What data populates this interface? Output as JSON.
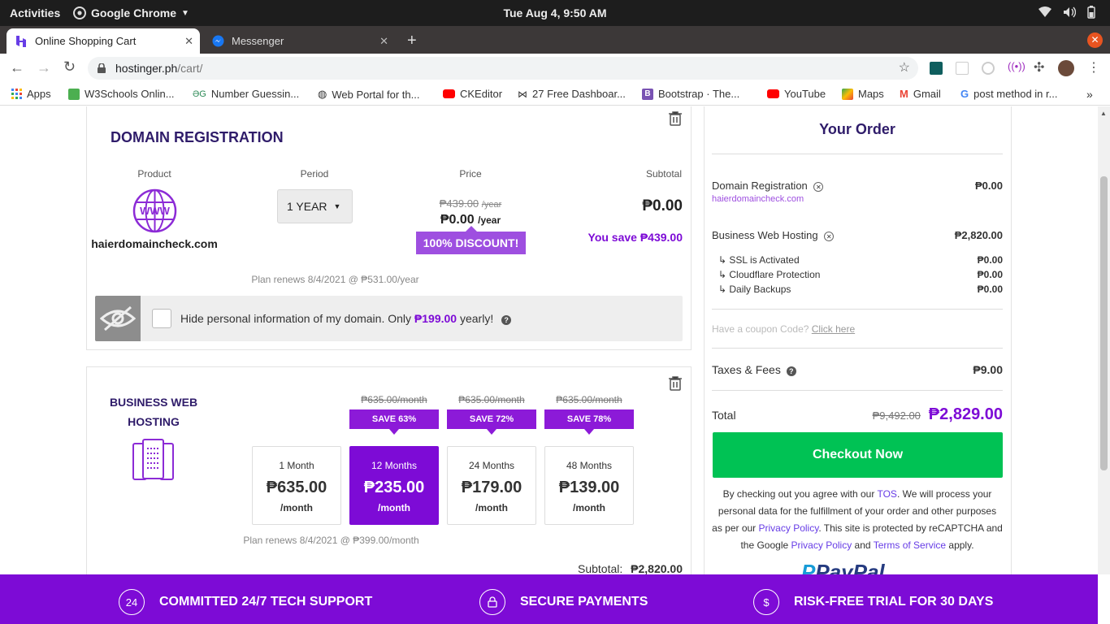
{
  "system": {
    "activities": "Activities",
    "app_name": "Google Chrome",
    "clock": "Tue Aug  4,  9:50 AM"
  },
  "tabs": [
    {
      "label": "Online Shopping Cart",
      "active": true
    },
    {
      "label": "Messenger",
      "active": false
    }
  ],
  "toolbar": {
    "url_host": "hostinger.ph",
    "url_path": "/cart/"
  },
  "bookmarks": [
    {
      "label": "Apps",
      "icon": "apps-grid-icon"
    },
    {
      "label": "W3Schools Onlin...",
      "icon": "w3schools-icon"
    },
    {
      "label": "Number Guessin...",
      "icon": "number-guessing-icon"
    },
    {
      "label": "Web Portal for th...",
      "icon": "globe-icon"
    },
    {
      "label": "CKEditor",
      "icon": "youtube-icon"
    },
    {
      "label": "27 Free Dashboar...",
      "icon": "bow-icon"
    },
    {
      "label": "Bootstrap · The...",
      "icon": "bootstrap-icon"
    },
    {
      "label": "YouTube",
      "icon": "youtube-icon"
    },
    {
      "label": "Maps",
      "icon": "maps-icon"
    },
    {
      "label": "Gmail",
      "icon": "gmail-icon"
    },
    {
      "label": "post method in r...",
      "icon": "google-icon"
    }
  ],
  "domain": {
    "title": "DOMAIN REGISTRATION",
    "col_product": "Product",
    "col_period": "Period",
    "col_price": "Price",
    "col_subtotal": "Subtotal",
    "domain_name": "haierdomaincheck.com",
    "period": "1 YEAR",
    "old_price": "₱439.00",
    "old_price_unit": "/year",
    "new_price": "₱0.00",
    "new_price_unit": "/year",
    "discount": "100% DISCOUNT!",
    "subtotal": "₱0.00",
    "you_save": "You save ₱439.00",
    "renews": "Plan renews 8/4/2021 @ ₱531.00/year",
    "privacy_text_before": "Hide personal information of my domain. Only",
    "privacy_price": "₱199.00",
    "privacy_text_after": "yearly!"
  },
  "hosting": {
    "title_line1": "BUSINESS WEB",
    "title_line2": "HOSTING",
    "plans": [
      {
        "label": "1 Month",
        "price": "₱635.00",
        "unit": "/month",
        "old": "",
        "save": ""
      },
      {
        "label": "12 Months",
        "price": "₱235.00",
        "unit": "/month",
        "old": "₱635.00/month",
        "save": "SAVE 63%"
      },
      {
        "label": "24 Months",
        "price": "₱179.00",
        "unit": "/month",
        "old": "₱635.00/month",
        "save": "SAVE 72%"
      },
      {
        "label": "48 Months",
        "price": "₱139.00",
        "unit": "/month",
        "old": "₱635.00/month",
        "save": "SAVE 78%"
      }
    ],
    "selected_index": 1,
    "renews": "Plan renews 8/4/2021 @ ₱399.00/month",
    "subtotal_label": "Subtotal:",
    "subtotal_value": "₱2,820.00"
  },
  "order": {
    "title": "Your Order",
    "items": [
      {
        "name": "Domain Registration",
        "value": "₱0.00",
        "sub": "haierdomaincheck.com"
      },
      {
        "name": "Business Web Hosting",
        "value": "₱2,820.00"
      }
    ],
    "addons": [
      {
        "name": "↳ SSL is Activated",
        "value": "₱0.00"
      },
      {
        "name": "↳ Cloudflare Protection",
        "value": "₱0.00"
      },
      {
        "name": "↳ Daily Backups",
        "value": "₱0.00"
      }
    ],
    "coupon_text": "Have a coupon Code?",
    "coupon_link": "Click here",
    "taxes_label": "Taxes & Fees",
    "taxes_value": "₱9.00",
    "total_label": "Total",
    "total_old": "₱9,492.00",
    "total_new": "₱2,829.00",
    "checkout": "Checkout Now",
    "legal_1": "By checking out you agree with our",
    "legal_tos": "TOS",
    "legal_2": ". We will process your personal data for the fulfillment of your order and other purposes as per our",
    "legal_privacy": "Privacy Policy",
    "legal_3": ". This site is protected by reCAPTCHA and the Google",
    "legal_privacy2": "Privacy Policy",
    "legal_4": "and",
    "legal_terms": "Terms of Service",
    "legal_5": "apply.",
    "paypal": "PayPal"
  },
  "footer": {
    "support_icon_text": "24",
    "support": "COMMITTED 24/7 TECH SUPPORT",
    "secure": "SECURE PAYMENTS",
    "trial_icon_text": "$",
    "trial": "RISK-FREE TRIAL FOR 30 DAYS"
  },
  "colors": {
    "brand_purple": "#7d0bd6",
    "link_purple": "#673de6",
    "checkout_green": "#00c254"
  }
}
